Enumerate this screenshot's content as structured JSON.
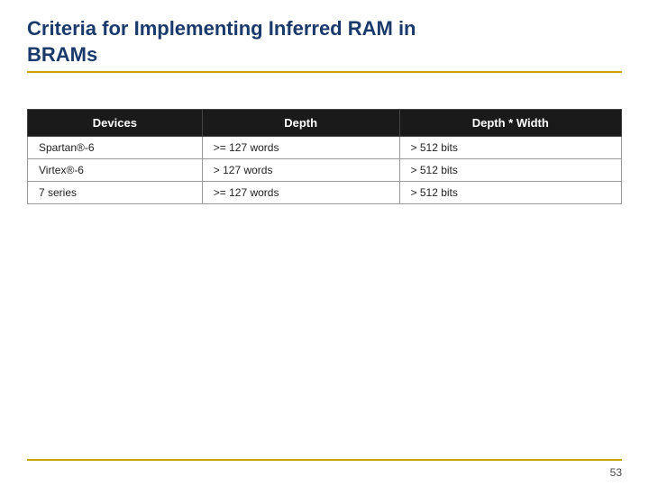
{
  "title": {
    "line1": "Criteria for Implementing Inferred RAM in",
    "line2": "BRAMs"
  },
  "table": {
    "headers": [
      "Devices",
      "Depth",
      "Depth * Width"
    ],
    "rows": [
      [
        "Spartan®-6",
        ">= 127 words",
        "> 512 bits"
      ],
      [
        "Virtex®-6",
        ">   127 words",
        "> 512 bits"
      ],
      [
        "7 series",
        ">= 127 words",
        "> 512 bits"
      ]
    ]
  },
  "page_number": "53"
}
